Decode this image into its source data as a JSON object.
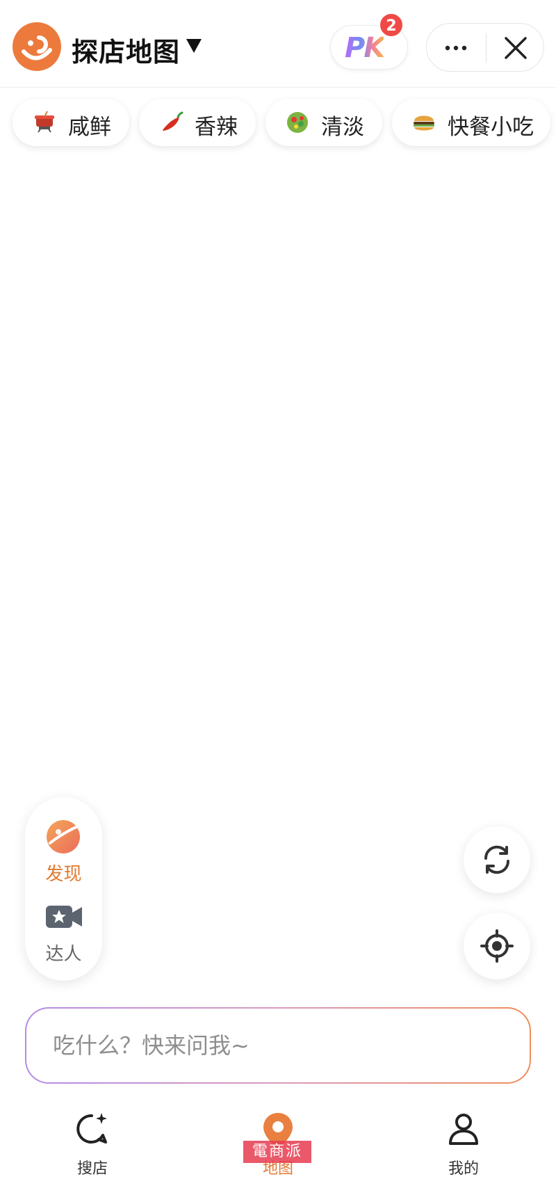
{
  "header": {
    "title": "探店地图",
    "pk_label": "PK",
    "pk_badge_count": "2"
  },
  "categories": [
    {
      "label": "咸鲜",
      "icon": "hotpot-icon"
    },
    {
      "label": "香辣",
      "icon": "chili-pepper-icon"
    },
    {
      "label": "清淡",
      "icon": "salad-icon"
    },
    {
      "label": "快餐小吃",
      "icon": "burger-icon"
    }
  ],
  "side_panel": {
    "discover_label": "发现",
    "expert_label": "达人"
  },
  "search": {
    "placeholder": "吃什么？快来问我~"
  },
  "bottom_nav": [
    {
      "label": "搜店",
      "active": false
    },
    {
      "label": "地图",
      "active": true
    },
    {
      "label": "我的",
      "active": false
    }
  ],
  "watermark": "電商派",
  "colors": {
    "brand_orange": "#ec7a3c",
    "badge_red": "#f04a47",
    "active_nav": "#e37a36",
    "input_border_start": "#b48ae6",
    "input_border_end": "#ef8d5a"
  }
}
